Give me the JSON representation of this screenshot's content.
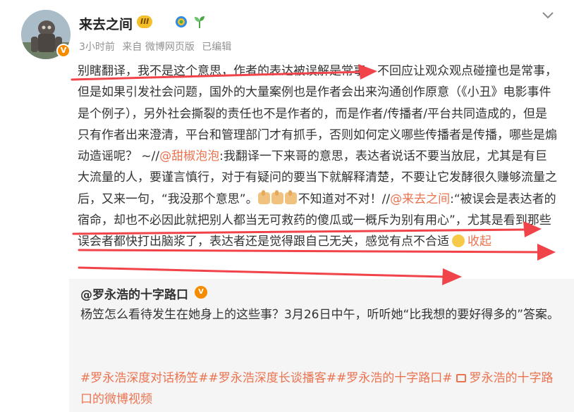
{
  "post": {
    "author": "来去之间",
    "level_badge": "III",
    "meta": {
      "time": "3小时前",
      "source": "来自 微博网页版",
      "edited": "已编辑"
    },
    "body": {
      "p1": "别瞎翻译，我不是这个意思，作者的表达被误解是常事，不回应让观众观点碰撞也是常事，但是如果引发社会问题，国外的大量案例也是作者会出来沟通创作原意（《小丑》电影事件是个例子），另外社会撕裂的责任也不是作者的，而是作者/传播者/平台共同造成的，但是只有作者出来澄清，平台和管理部门才有抓手，否则如何定义哪些传播者是传播，哪些是煽动造谣呢？ ~//",
      "mention1": "@甜椒泡泡",
      "p2": ":我翻译一下来哥的意思，表达者说话不要当放屁，尤其是有巨大流量的人，要谨言慎行，对于有疑问的要当下就解释清楚，不要让它发酵很久赚够流量之后，又来一句，“我没那个意思”。",
      "p3": "不知道对不对！//",
      "mention2": "@来去之间",
      "p4": ":“被误会是表达者的宿命，却也不必因此就把别人都当无可救药的傻瓜或一概斥为别有用心”，尤其是看到那些误会者都快打出脑浆了，表达者还是觉得跟自己无关，感觉有点不合适",
      "collapse": "收起"
    }
  },
  "repost": {
    "author": "@罗永浩的十字路口",
    "text": "杨笠怎么看待发生在她身上的这些事？3月26日中午，听听她“比我想的要好得多的”答案。",
    "tags": "#罗永浩深度对话杨笠##罗永浩深度长谈播客##罗永浩的十字路口#",
    "video_link": "罗永浩的十字路口的微博视频"
  },
  "colors": {
    "accent": "#eb7350",
    "annotation_arrow": "#f0444a",
    "repost_bg": "#f5f5f5",
    "meta_text": "#939393"
  },
  "icons": [
    "verified-badge-icon",
    "medal-icon",
    "sprout-icon",
    "chevron-down-icon",
    "thumbs-up-icon",
    "shrug-emoji-icon",
    "video-icon"
  ]
}
